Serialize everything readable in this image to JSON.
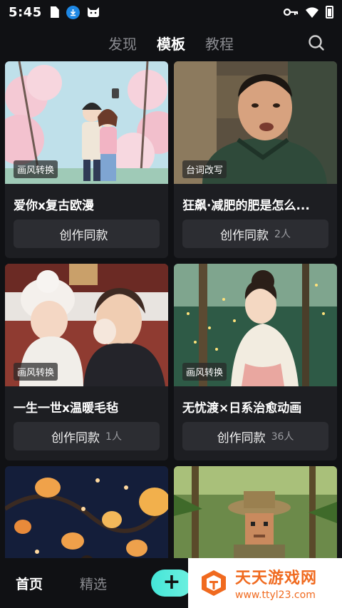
{
  "status_bar": {
    "time": "5:45",
    "icons": [
      "sim-card-icon",
      "download-icon",
      "cat-icon",
      "vpn-key-icon",
      "wifi-icon",
      "battery-icon"
    ]
  },
  "top_nav": {
    "tabs": [
      {
        "label": "发现",
        "active": false
      },
      {
        "label": "模板",
        "active": true
      },
      {
        "label": "教程",
        "active": false
      }
    ],
    "search_icon": "search-icon"
  },
  "cards": [
    {
      "tag": "画风转换",
      "title": "爱你x复古欧漫",
      "button": "创作同款",
      "count": ""
    },
    {
      "tag": "台词改写",
      "title": "狂飙·减肥的肥是怎么...",
      "button": "创作同款",
      "count": "2人"
    },
    {
      "tag": "画风转换",
      "title": "一生一世x温暖毛毡",
      "button": "创作同款",
      "count": "1人"
    },
    {
      "tag": "画风转换",
      "title": "无忧渡×日系治愈动画",
      "button": "创作同款",
      "count": "36人"
    }
  ],
  "bottom_nav": {
    "items": [
      {
        "label": "首页",
        "active": true
      },
      {
        "label": "精选",
        "active": false
      }
    ],
    "add_label": "+"
  },
  "watermark": {
    "title": "天天游戏网",
    "url": "www.ttyl23.com"
  },
  "colors": {
    "background": "#101114",
    "card": "#1d1e22",
    "button": "#2c2d32",
    "accent": "#4de8d9",
    "watermark": "#f06a1f"
  }
}
